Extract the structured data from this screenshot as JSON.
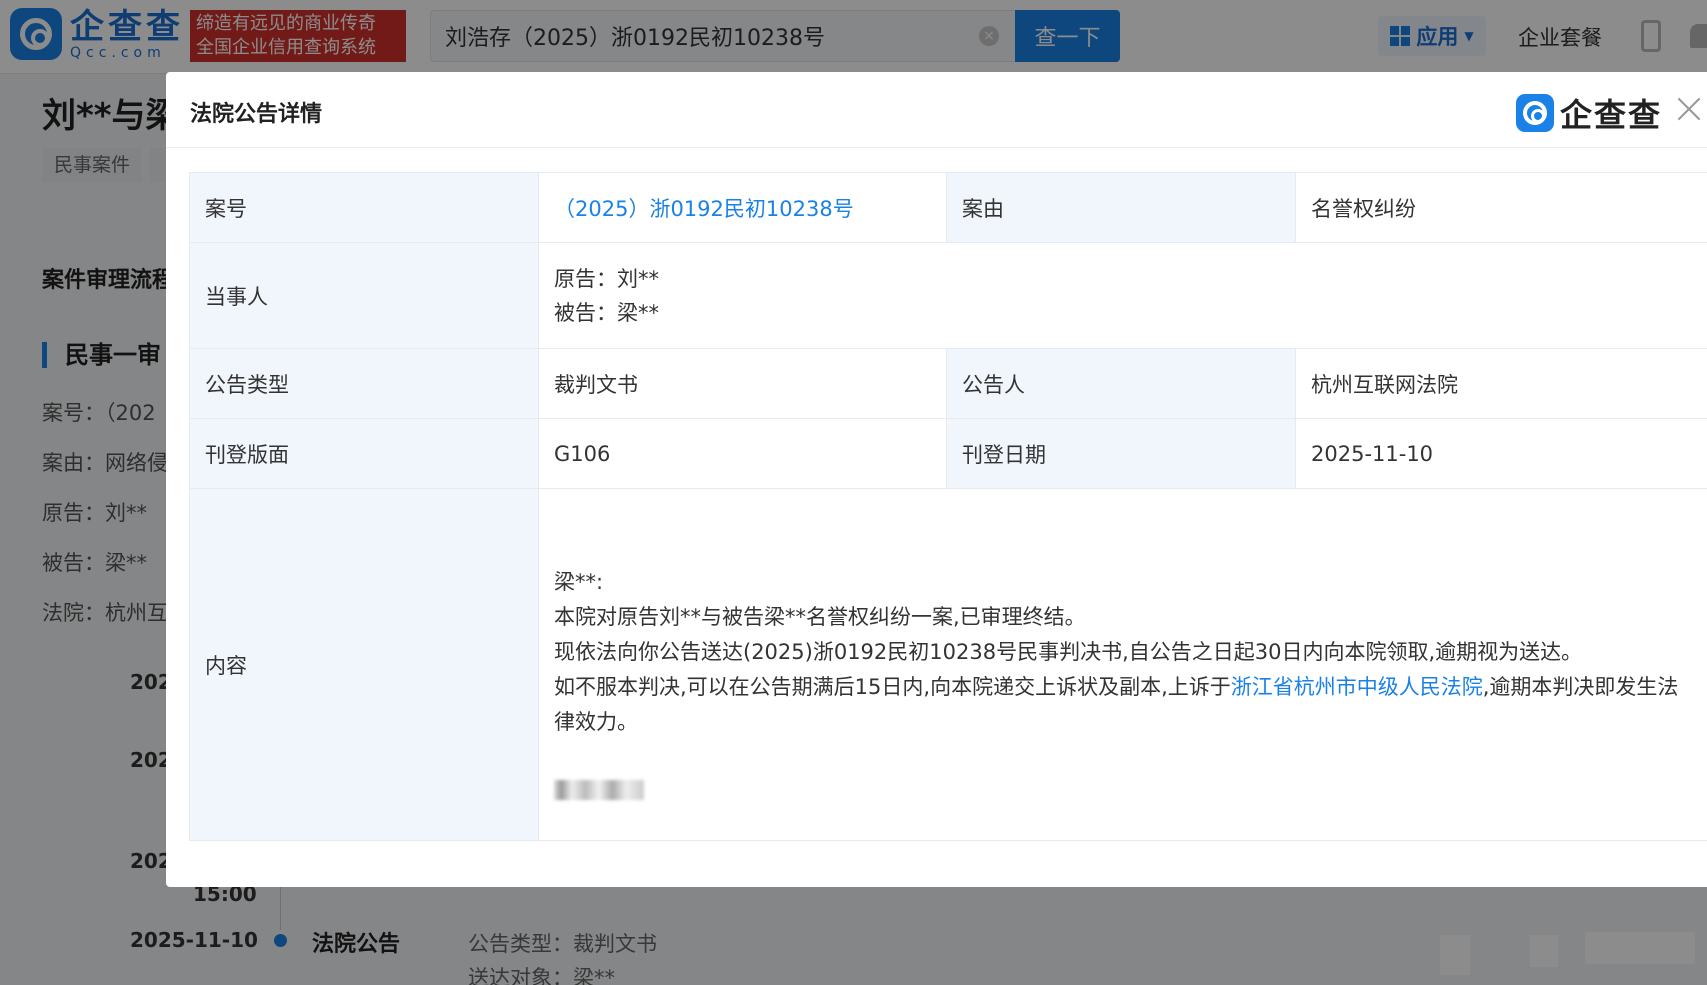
{
  "header": {
    "logo_cn": "企查查",
    "logo_en": "Qcc.com",
    "slogan_line1": "缔造有远见的商业传奇",
    "slogan_line2": "全国企业信用查询系统",
    "search_value": "刘浩存（2025）浙0192民初10238号",
    "search_button": "查一下",
    "apps_label": "应用",
    "package_label": "企业套餐"
  },
  "background": {
    "title": "刘**与梁",
    "tag": "民事案件",
    "section_title": "案件审理流程",
    "sub_title": "民事一审",
    "lines": [
      "案号：（202",
      "案由：网络侵",
      "原告：刘**",
      "被告：梁**",
      "法院：杭州互"
    ],
    "times": [
      "202",
      "202",
      "202",
      "15:00"
    ],
    "event_date": "2025-11-10",
    "event_name": "法院公告",
    "event_kv1": "公告类型：裁判文书",
    "event_kv2": "送达对象：梁**"
  },
  "modal": {
    "title": "法院公告详情",
    "logo_text": "企查查",
    "labels": {
      "case_no": "案号",
      "cause": "案由",
      "parties": "当事人",
      "notice_type": "公告类型",
      "announcer": "公告人",
      "page": "刊登版面",
      "date": "刊登日期",
      "content": "内容"
    },
    "values": {
      "case_no": "（2025）浙0192民初10238号",
      "cause": "名誉权纠纷",
      "plaintiff": "原告：刘**",
      "defendant": "被告：梁**",
      "notice_type": "裁判文书",
      "announcer": "杭州互联网法院",
      "page": "G106",
      "date": "2025-11-10"
    },
    "content": {
      "line1": "梁**:",
      "line2": "本院对原告刘**与被告梁**名誉权纠纷一案,已审理终结。",
      "line3": "现依法向你公告送达(2025)浙0192民初10238号民事判决书,自公告之日起30日内向本院领取,逾期视为送达。",
      "line4_pre": "如不服本判决,可以在公告期满后15日内,向本院递交上诉状及副本,上诉于",
      "line4_link": "浙江省杭州市中级人民法院",
      "line4_post": ",逾期本判决即发生法律效力。"
    }
  },
  "colors": {
    "brand": "#1a82e6",
    "label_bg": "#f1f6fc",
    "slogan_bg": "#d0312d"
  }
}
